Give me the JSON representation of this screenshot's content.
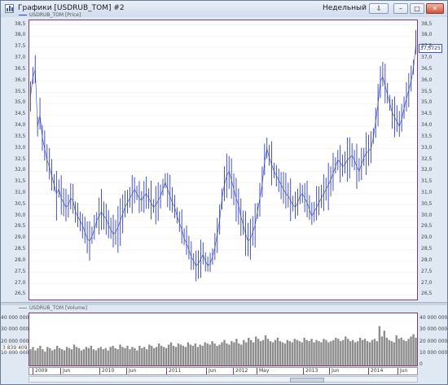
{
  "window": {
    "title": "Графики [USDRUB_TOM] #2",
    "period": "Недельный",
    "controls": {
      "dropdown": "⇩",
      "minimize": "–",
      "maximize": "□",
      "close": "✕"
    }
  },
  "price_panel": {
    "legend": "USDRUB_TOM [Price]",
    "last_price": "37,5725",
    "y_ticks": [
      "38,5",
      "38,0",
      "37,5",
      "37,0",
      "36,5",
      "36,0",
      "35,5",
      "35,0",
      "34,5",
      "34,0",
      "33,5",
      "33,0",
      "32,5",
      "32,0",
      "31,5",
      "31,0",
      "30,5",
      "30,0",
      "29,5",
      "29,0",
      "28,5",
      "28,0",
      "27,5",
      "27,0",
      "26,5"
    ],
    "line_color": "#2f3fc8"
  },
  "volume_panel": {
    "legend": "USDRUB_TOM [Volume]",
    "current_volume": "3 839 409",
    "left_ticks": [
      "40 000 000",
      "30 000 000",
      "20 000 000",
      "10 000 000"
    ],
    "right_ticks": [
      "40 000 000",
      "30 000 000",
      "20 000 000",
      "10 000 000",
      "0"
    ],
    "bar_color": "#8c8c8c"
  },
  "x_axis": {
    "labels": [
      "2009",
      "Jun",
      "2010",
      "Jun",
      "2011",
      "Jun",
      "2012",
      "May",
      "2013",
      "Jun",
      "2014",
      "Jun"
    ]
  },
  "chart_data": {
    "type": "line",
    "y_range": [
      26.3,
      38.7
    ],
    "price_weekly": [
      35.3,
      36.2,
      36.5,
      34.0,
      34.5,
      33.5,
      33.0,
      32.5,
      32.2,
      31.8,
      31.4,
      31.0,
      31.2,
      30.8,
      30.6,
      30.4,
      30.5,
      30.8,
      30.7,
      30.2,
      30.0,
      29.8,
      29.6,
      29.3,
      29.0,
      28.9,
      29.1,
      29.4,
      29.8,
      30.0,
      30.2,
      30.0,
      29.9,
      29.6,
      29.4,
      29.2,
      29.3,
      29.5,
      29.8,
      30.1,
      30.4,
      30.6,
      30.8,
      31.0,
      31.2,
      31.0,
      30.8,
      30.7,
      30.9,
      31.0,
      30.8,
      30.6,
      30.4,
      30.5,
      30.7,
      30.9,
      31.2,
      31.5,
      31.2,
      30.9,
      30.6,
      30.4,
      30.0,
      29.7,
      29.4,
      29.0,
      28.8,
      28.5,
      28.2,
      28.0,
      27.8,
      27.9,
      28.1,
      28.3,
      28.0,
      27.8,
      27.9,
      28.2,
      28.6,
      29.2,
      29.8,
      30.8,
      31.4,
      31.8,
      32.0,
      31.6,
      31.2,
      30.8,
      30.5,
      30.0,
      29.6,
      29.2,
      28.9,
      29.0,
      29.3,
      29.6,
      30.2,
      30.8,
      31.4,
      32.4,
      33.0,
      32.6,
      32.3,
      32.0,
      31.8,
      31.6,
      31.4,
      31.2,
      31.0,
      30.9,
      30.7,
      30.5,
      30.4,
      30.6,
      30.9,
      31.0,
      30.8,
      30.6,
      30.3,
      30.0,
      30.2,
      30.4,
      30.6,
      30.8,
      31.0,
      31.2,
      31.4,
      31.6,
      31.9,
      32.2,
      32.5,
      32.4,
      32.2,
      32.3,
      32.5,
      32.6,
      32.7,
      32.5,
      32.2,
      32.0,
      32.3,
      32.6,
      32.8,
      32.9,
      33.0,
      33.5,
      34.2,
      35.0,
      36.0,
      36.2,
      35.8,
      35.4,
      35.0,
      34.6,
      34.4,
      34.2,
      34.0,
      34.3,
      34.8,
      35.2,
      35.6,
      36.0,
      36.6,
      37.6
    ],
    "volume_weekly": [
      14,
      16,
      13,
      15,
      17,
      14,
      12,
      16,
      15,
      13,
      14,
      17,
      15,
      14,
      13,
      16,
      15,
      14,
      18,
      16,
      15,
      13,
      14,
      16,
      15,
      17,
      14,
      13,
      15,
      16,
      14,
      15,
      13,
      16,
      17,
      15,
      14,
      18,
      16,
      15,
      17,
      14,
      16,
      15,
      13,
      17,
      15,
      16,
      14,
      18,
      17,
      15,
      16,
      19,
      17,
      16,
      15,
      18,
      20,
      17,
      16,
      19,
      18,
      17,
      16,
      20,
      18,
      17,
      19,
      16,
      18,
      17,
      20,
      19,
      18,
      21,
      19,
      17,
      18,
      20,
      22,
      19,
      18,
      21,
      20,
      23,
      19,
      18,
      22,
      20,
      24,
      22,
      20,
      25,
      23,
      21,
      22,
      26,
      23,
      21,
      20,
      22,
      24,
      21,
      20,
      19,
      22,
      21,
      20,
      23,
      22,
      21,
      20,
      24,
      22,
      21,
      23,
      20,
      22,
      21,
      20,
      23,
      22,
      20,
      21,
      22,
      24,
      23,
      21,
      22,
      25,
      23,
      21,
      22,
      20,
      21,
      24,
      22,
      23,
      21,
      20,
      22,
      23,
      21,
      34,
      25,
      30,
      24,
      22,
      21,
      20,
      26,
      23,
      24,
      22,
      21,
      23,
      25,
      27,
      24
    ]
  }
}
